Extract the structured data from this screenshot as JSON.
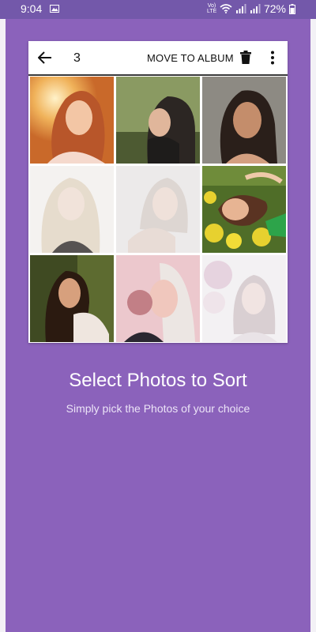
{
  "status_bar": {
    "time": "9:04",
    "battery": "72%",
    "network_label": "Vo) LTE"
  },
  "toolbar": {
    "count": "3",
    "move_to_album": "MOVE TO ALBUM",
    "icons": [
      "back-arrow-icon",
      "trash-icon",
      "more-vert-icon"
    ]
  },
  "photos": [
    {
      "name": "photo-1",
      "palette": [
        "#f0b25a",
        "#e98d3b"
      ]
    },
    {
      "name": "photo-2",
      "palette": [
        "#6e7a4a",
        "#3b3a2f"
      ]
    },
    {
      "name": "photo-3",
      "palette": [
        "#9a968f",
        "#4c3b30"
      ]
    },
    {
      "name": "photo-4",
      "palette": [
        "#f3f0ee",
        "#cfc7bf"
      ]
    },
    {
      "name": "photo-5",
      "palette": [
        "#ece8e6",
        "#c9c1bd"
      ]
    },
    {
      "name": "photo-6",
      "palette": [
        "#5c7d2f",
        "#e8d133"
      ]
    },
    {
      "name": "photo-7",
      "palette": [
        "#49512b",
        "#2d2b1d"
      ]
    },
    {
      "name": "photo-8",
      "palette": [
        "#e8c3c9",
        "#2b2930"
      ]
    },
    {
      "name": "photo-9",
      "palette": [
        "#f0eef1",
        "#d8d2da"
      ]
    }
  ],
  "content": {
    "title": "Select Photos to Sort",
    "subtitle": "Simply pick the Photos of your choice"
  },
  "colors": {
    "status_bar": "#7358aa",
    "background": "#8b62bb"
  }
}
